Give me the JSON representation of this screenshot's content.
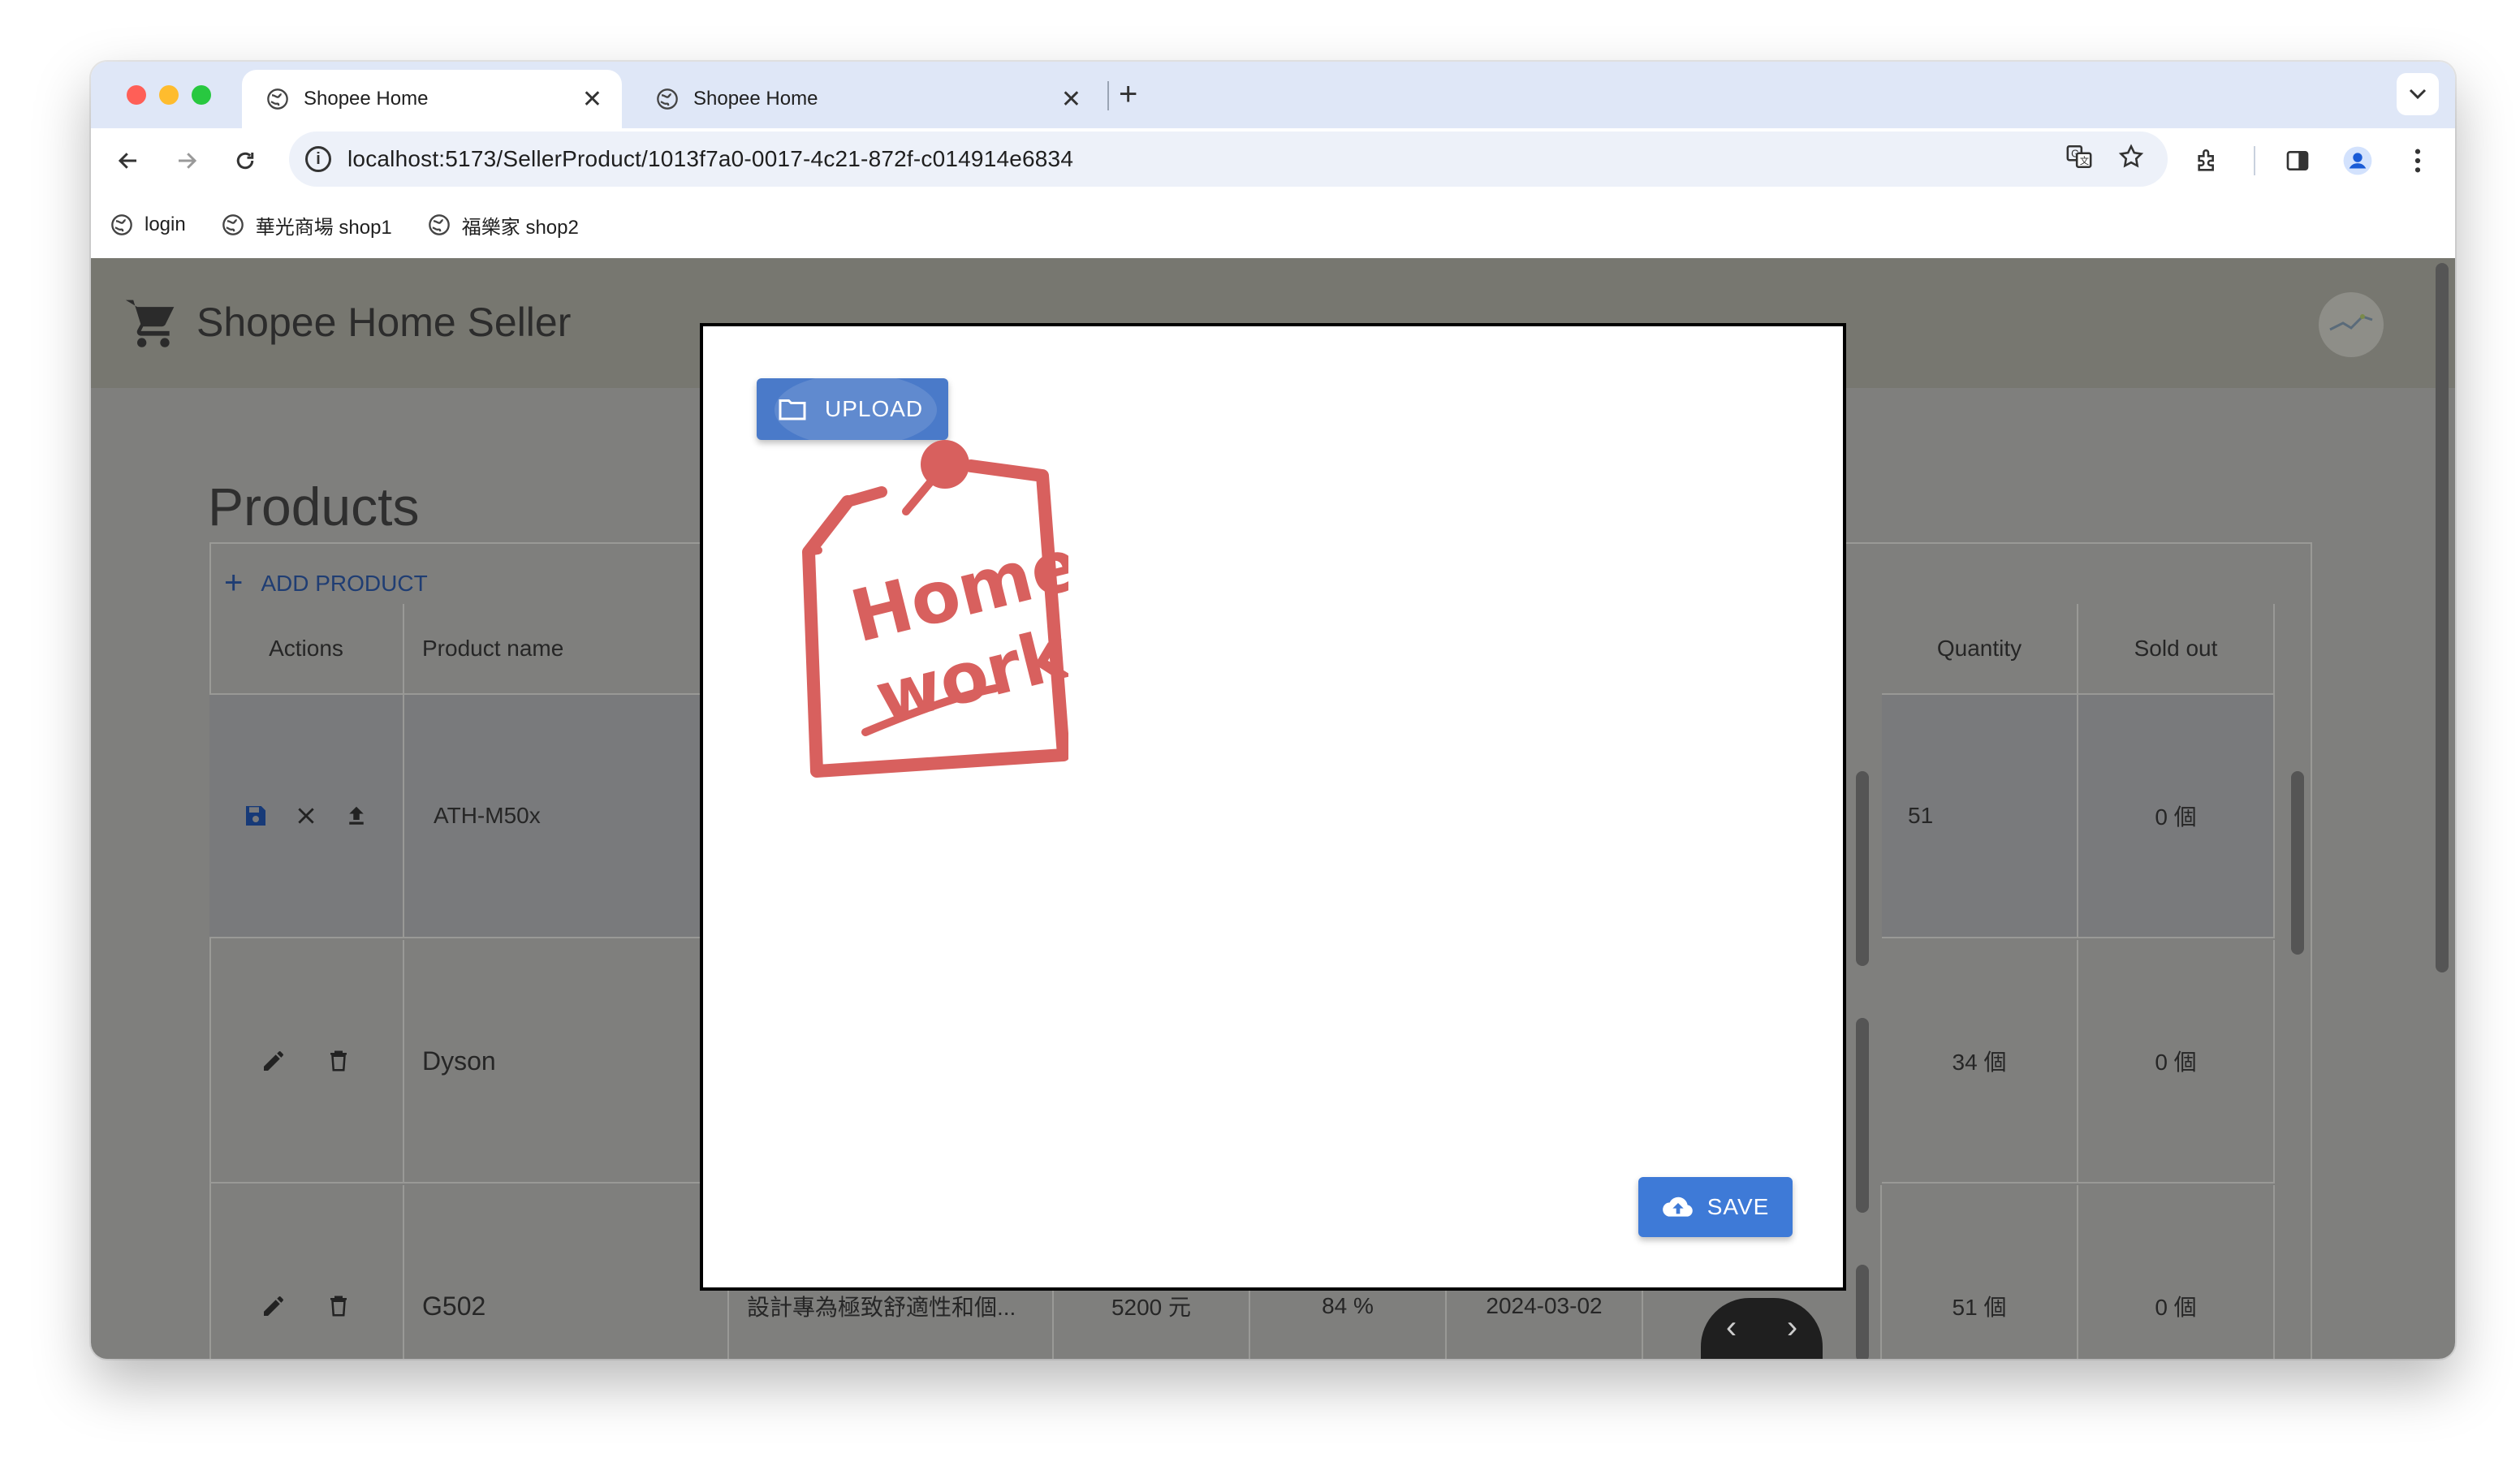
{
  "browser": {
    "tabs": [
      {
        "title": "Shopee Home",
        "active": true
      },
      {
        "title": "Shopee Home",
        "active": false
      }
    ],
    "url": "localhost:5173/SellerProduct/1013f7a0-0017-4c21-872f-c014914e6834",
    "bookmarks": [
      {
        "label": "login"
      },
      {
        "label": "華光商場 shop1"
      },
      {
        "label": "福樂家 shop2"
      }
    ]
  },
  "app": {
    "title": "Shopee Home Seller",
    "page_title": "Products",
    "add_product_label": "ADD PRODUCT",
    "columns": {
      "actions": "Actions",
      "product_name": "Product name",
      "quantity": "Quantity",
      "sold_out": "Sold out"
    },
    "rows": [
      {
        "name": "ATH-M50x",
        "quantity": "51",
        "sold_out": "0 個"
      },
      {
        "name": "Dyson",
        "quantity": "34 個",
        "sold_out": "0 個"
      },
      {
        "name": "G502",
        "description": "設計專為極致舒適性和個...",
        "price": "5200 元",
        "discount": "84 %",
        "date": "2024-03-02",
        "quantity": "51 個",
        "sold_out": "0 個"
      }
    ]
  },
  "modal": {
    "upload_label": "UPLOAD",
    "save_label": "SAVE",
    "preview_alt": "Home-work!"
  },
  "colors": {
    "upload_button": "#4a7ac9",
    "save_button": "#3e7ad7",
    "sticker_red": "#d8605e"
  }
}
